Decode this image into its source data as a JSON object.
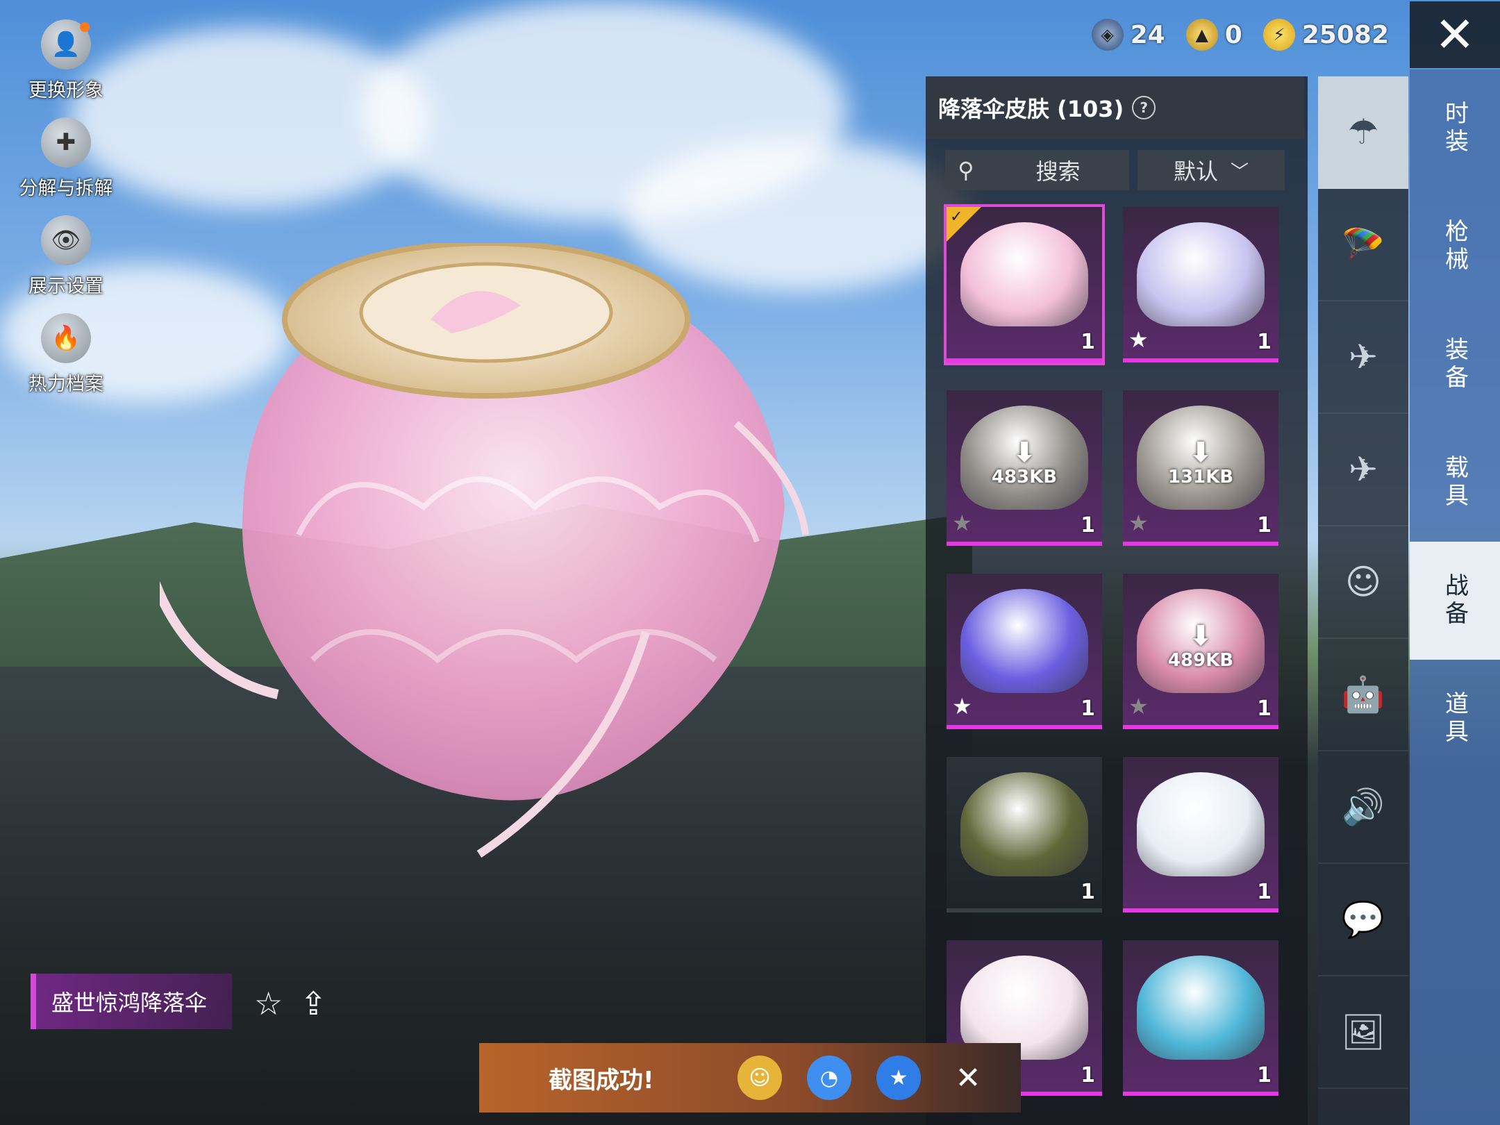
{
  "left_menu": [
    {
      "label": "更换形象",
      "icon": "avatar-icon"
    },
    {
      "label": "分解与拆解",
      "icon": "puzzle-icon"
    },
    {
      "label": "展示设置",
      "icon": "eye-icon"
    },
    {
      "label": "热力档案",
      "icon": "flame-icon"
    }
  ],
  "currencies": [
    {
      "icon": "blue-coin-icon",
      "value": "24"
    },
    {
      "icon": "gold-coin-icon",
      "value": "0"
    },
    {
      "icon": "bolt-coin-icon",
      "value": "25082"
    }
  ],
  "panel": {
    "title": "降落伞皮肤 (103)",
    "search_label": "搜索",
    "sort_label": "默认"
  },
  "items": [
    {
      "count": "1",
      "selected": true,
      "star": "none",
      "download": "",
      "rarity": "purple",
      "color": "#f3bfd8"
    },
    {
      "count": "1",
      "selected": false,
      "star": "white",
      "download": "",
      "rarity": "purple",
      "color": "#c9c3f0"
    },
    {
      "count": "1",
      "selected": false,
      "star": "gray",
      "download": "483KB",
      "rarity": "purple",
      "color": "#8e8a86"
    },
    {
      "count": "1",
      "selected": false,
      "star": "gray",
      "download": "131KB",
      "rarity": "purple",
      "color": "#9c9790"
    },
    {
      "count": "1",
      "selected": false,
      "star": "white",
      "download": "",
      "rarity": "purple",
      "color": "#6a5fe0"
    },
    {
      "count": "1",
      "selected": false,
      "star": "gray",
      "download": "489KB",
      "rarity": "purple",
      "color": "#d78aa8"
    },
    {
      "count": "1",
      "selected": false,
      "star": "none",
      "download": "",
      "rarity": "plain",
      "color": "#5f6638"
    },
    {
      "count": "1",
      "selected": false,
      "star": "none",
      "download": "",
      "rarity": "purple",
      "color": "#e8eef6"
    },
    {
      "count": "1",
      "selected": false,
      "star": "none",
      "download": "",
      "rarity": "purple",
      "color": "#f4e4ec"
    },
    {
      "count": "1",
      "selected": false,
      "star": "none",
      "download": "",
      "rarity": "purple",
      "color": "#4fb6d8"
    }
  ],
  "side_tabs_icons": [
    "parachute-icon",
    "skydiver-icon",
    "drone-icon",
    "plane-icon",
    "emote-icon",
    "robot-icon",
    "speaker-icon",
    "chat-icon",
    "gallery-icon"
  ],
  "categories": [
    "时装",
    "枪械",
    "装备",
    "载具",
    "战备",
    "道具"
  ],
  "active_category": "战备",
  "item_name": "盛世惊鸿降落伞",
  "toast": {
    "message": "截图成功!"
  }
}
